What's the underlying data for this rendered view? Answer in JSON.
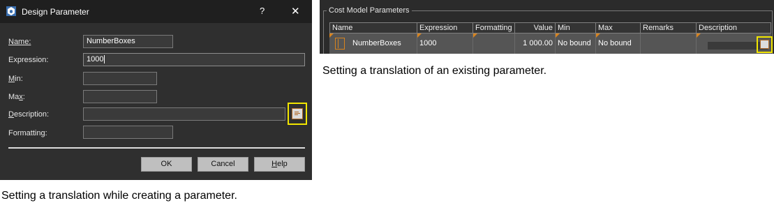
{
  "dialog": {
    "title": "Design Parameter",
    "help_glyph": "?",
    "close_glyph": "✕",
    "labels": {
      "name": "Name:",
      "expression": "Expression:",
      "min_prefix": "",
      "min_mnemonic": "M",
      "min_rest": "in:",
      "max_prefix": "Ma",
      "max_mnemonic": "x",
      "max_rest": ":",
      "description_prefix": "",
      "description_mnemonic": "D",
      "description_rest": "escription:",
      "formatting": "Formatting:"
    },
    "name_value": "NumberBoxes",
    "expression_value": "1000",
    "min_value": "",
    "max_value": "",
    "description_value": "",
    "formatting_value": "",
    "buttons": {
      "ok": "OK",
      "cancel": "Cancel",
      "help_mnemonic": "H",
      "help_rest": "elp"
    }
  },
  "panel": {
    "group_title": "Cost Model Parameters",
    "columns": [
      "Name",
      "Expression",
      "Formatting",
      "Value",
      "Min",
      "Max",
      "Remarks",
      "Description"
    ],
    "row": {
      "name": "NumberBoxes",
      "expression": "1000",
      "formatting": "",
      "value": "1 000.00",
      "min": "No bound",
      "max": "No bound",
      "remarks": "",
      "description": ""
    }
  },
  "captions": {
    "left": "Setting a translation while creating a parameter.",
    "right": "Setting a translation of an existing parameter."
  },
  "colors": {
    "highlight": "#f2e600",
    "accent_orange": "#d8841f",
    "dialog_bg": "#2f2f2f"
  },
  "icons": [
    "app-icon",
    "help-icon",
    "close-icon",
    "description-editor-icon",
    "parameter-icon"
  ]
}
